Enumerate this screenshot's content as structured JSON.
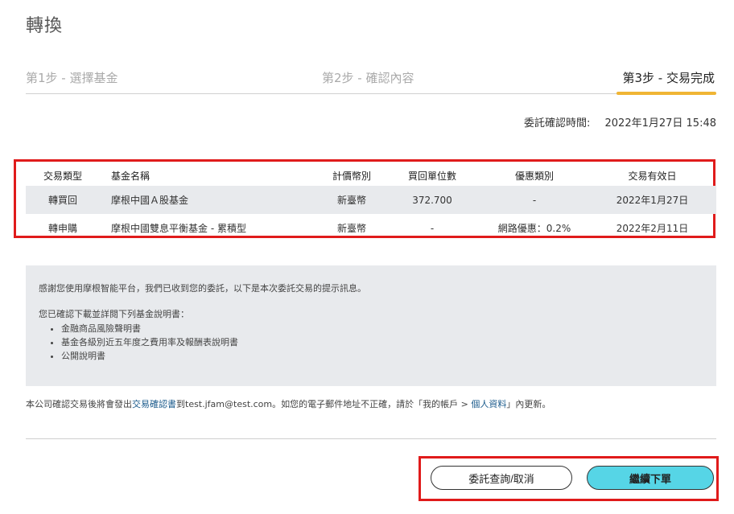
{
  "page": {
    "title": "轉換"
  },
  "steps": [
    {
      "label": "第1步 - 選擇基金"
    },
    {
      "label": "第2步 - 確認內容"
    },
    {
      "label": "第3步 - 交易完成"
    }
  ],
  "timestamp": {
    "label": "委託確認時間:",
    "value": "2022年1月27日 15:48"
  },
  "table": {
    "headers": [
      "交易類型",
      "基金名稱",
      "計價幣別",
      "買回單位數",
      "優惠類別",
      "交易有效日"
    ],
    "rows": [
      [
        "轉買回",
        "摩根中國Ａ股基金",
        "新臺幣",
        "372.700",
        "-",
        "2022年1月27日"
      ],
      [
        "轉申購",
        "摩根中國雙息平衡基金 - 累積型",
        "新臺幣",
        "-",
        "網路優惠：0.2%",
        "2022年2月11日"
      ]
    ]
  },
  "notice": {
    "line1": "感謝您使用摩根智能平台，我們已收到您的委託，以下是本次委託交易的提示訊息。",
    "line2": "您已確認下載並詳閱下列基金說明書：",
    "items": [
      "金融商品風險聲明書",
      "基金各級別近五年度之費用率及報酬表說明書",
      "公開說明書"
    ]
  },
  "email_note": {
    "part1": "本公司確認交易後將會發出",
    "link1": "交易確認書",
    "part2": "到test.jfam@test.com。如您的電子郵件地址不正確，請於「我的帳戶 > ",
    "link2": "個人資料",
    "part3": "」內更新。"
  },
  "buttons": {
    "query": "委託查詢/取消",
    "continue": "繼續下單"
  },
  "colors": {
    "accent": "#f0b534",
    "primary_button": "#56d5e6",
    "highlight_box": "#e01b1b"
  }
}
